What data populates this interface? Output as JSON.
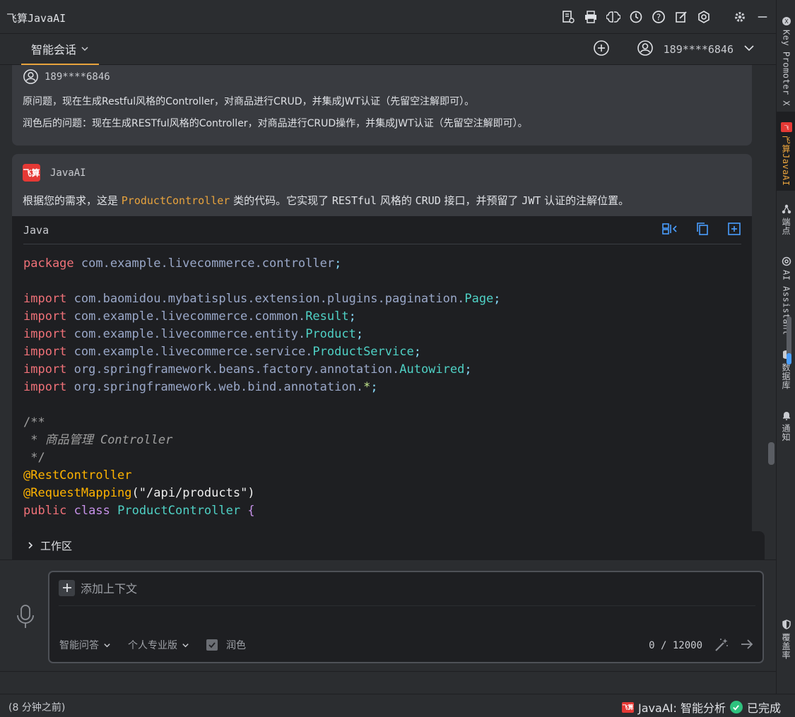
{
  "window": {
    "title": "飞算JavaAI"
  },
  "tab": {
    "label": "智能会话"
  },
  "account": {
    "phone": "189****6846"
  },
  "question": {
    "user": "189****6846",
    "original": "原问题，现在生成Restful风格的Controller，对商品进行CRUD，并集成JWT认证（先留空注解即可）。",
    "polished": "润色后的问题：现在生成RESTful风格的Controller，对商品进行CRUD操作，并集成JWT认证（先留空注解即可）。"
  },
  "answer": {
    "author": "JavaAI",
    "logo_text": "飞算",
    "intro_before": "根据您的需求，这是 ",
    "intro_class": "ProductController",
    "intro_mid": " 类的代码。它实现了 ",
    "intro_restful": "RESTful",
    "intro_mid2": " 风格的 ",
    "intro_crud": "CRUD",
    "intro_mid3": " 接口，并预留了 ",
    "intro_jwt": "JWT",
    "intro_after": " 认证的注解位置。"
  },
  "code": {
    "language": "Java",
    "package_kw": "package",
    "package_name": " com.example.livecommerce.controller",
    "semicolon": ";",
    "imports": [
      {
        "kw": "import",
        "path": " com.baomidou.mybatisplus.extension.plugins.pagination.",
        "cls": "Page"
      },
      {
        "kw": "import",
        "path": " com.example.livecommerce.common.",
        "cls": "Result"
      },
      {
        "kw": "import",
        "path": " com.example.livecommerce.entity.",
        "cls": "Product"
      },
      {
        "kw": "import",
        "path": " com.example.livecommerce.service.",
        "cls": "ProductService"
      },
      {
        "kw": "import",
        "path": " org.springframework.beans.factory.annotation.",
        "cls": "Autowired"
      },
      {
        "kw": "import",
        "path": " org.springframework.web.bind.annotation.",
        "cls": "*"
      }
    ],
    "comment_open": "/**",
    "comment_star": " * ",
    "comment_text": "商品管理 Controller",
    "comment_close": " */",
    "ann1": "@RestController",
    "ann2": "@RequestMapping",
    "ann2_arg": "\"/api/products\"",
    "class_public": "public",
    "class_kw": "class",
    "class_name": "ProductController",
    "brace": "{"
  },
  "workspace": {
    "label": "工作区"
  },
  "input": {
    "placeholder": "添加上下文",
    "mode": "智能问答",
    "edition": "个人专业版",
    "polish": "润色",
    "counter": "0 / 12000"
  },
  "right_tools": [
    {
      "label": "Key Promoter X",
      "icon": "key-promoter-icon"
    },
    {
      "label": "飞算JavaAI",
      "icon": "feisuan-icon"
    },
    {
      "label": "端点",
      "icon": "endpoints-icon"
    },
    {
      "label": "AI Assistant",
      "icon": "ai-assistant-icon"
    },
    {
      "label": "数据库",
      "icon": "database-icon"
    },
    {
      "label": "通知",
      "icon": "notification-icon"
    },
    {
      "label": "覆盖率",
      "icon": "coverage-icon"
    }
  ],
  "status": {
    "left": "(8 分钟之前)",
    "task": "JavaAI: 智能分析",
    "state": "已完成",
    "logo_text": "飞算"
  },
  "colors": {
    "accent": "#e8a33d",
    "brand": "#e53935",
    "success": "#2ec27e"
  }
}
